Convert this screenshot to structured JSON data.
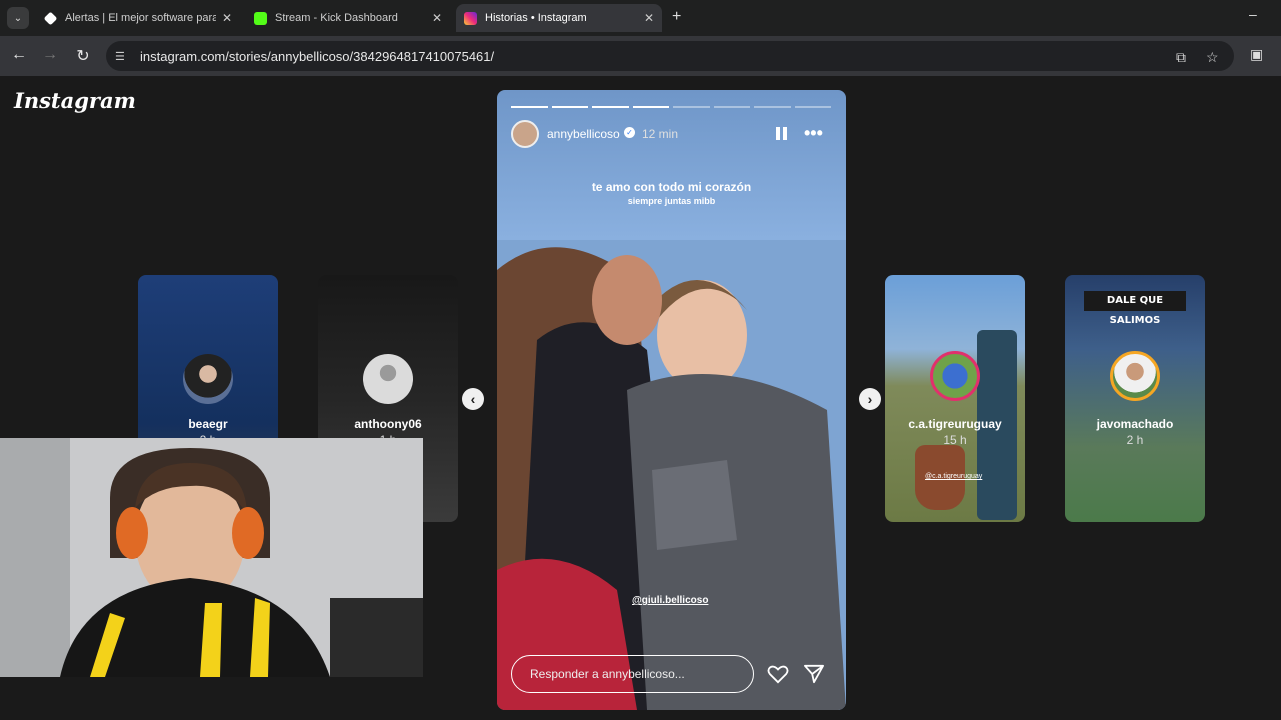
{
  "browser": {
    "tabs": [
      {
        "label": "Alertas | El mejor software para",
        "close": "✕"
      },
      {
        "label": "Stream - Kick Dashboard",
        "close": "✕"
      },
      {
        "label": "Historias • Instagram",
        "close": "✕"
      }
    ],
    "new_tab": "+",
    "minimize": "–",
    "url": "instagram.com/stories/annybellicoso/3842964817410075461/"
  },
  "instagram": {
    "logo": "Instagram",
    "side_stories": [
      {
        "user": "beaegr",
        "time": "2 h"
      },
      {
        "user": "anthoony06",
        "time": "1 h"
      },
      {
        "user": "c.a.tigreuruguay",
        "time": "15 h"
      },
      {
        "user": "javomachado",
        "time": "2 h"
      }
    ],
    "story": {
      "user": "annybellicoso",
      "time": "12 min",
      "caption": "te amo con todo mi corazón",
      "subcaption": "siempre juntas mibb",
      "mention": "@giuli.bellicoso",
      "reply_placeholder": "Responder a annybellicoso...",
      "progress": {
        "segments": 8,
        "completed": 4
      }
    },
    "side_overlays": {
      "tigre_sticker": "@c.a.tigreuruguay",
      "javo_banner": "DALE QUE SALIMOS"
    }
  }
}
